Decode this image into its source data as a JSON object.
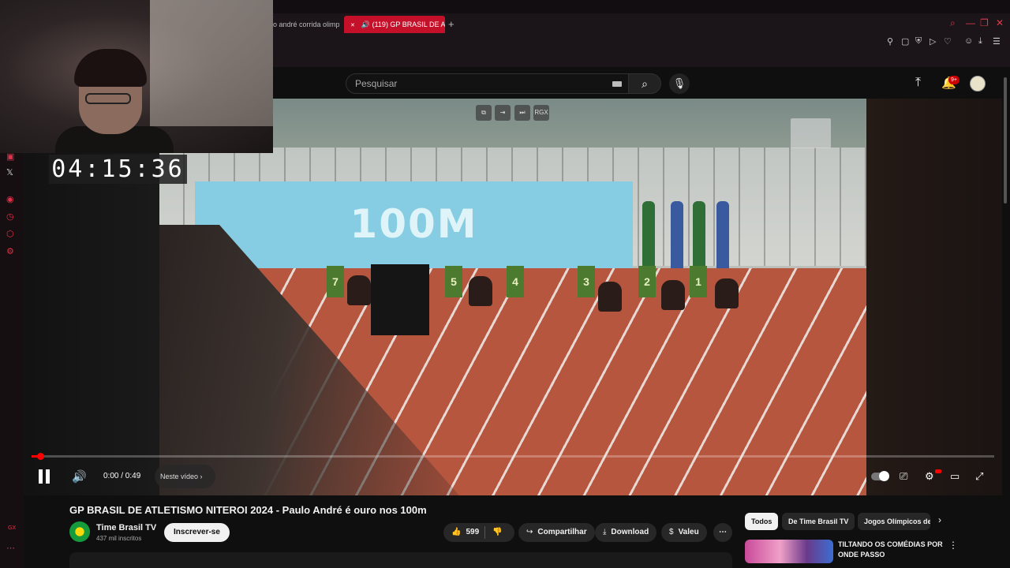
{
  "browser": {
    "tabs": [
      {
        "label": "o andré corrida olimp"
      },
      {
        "label": "(119) GP BRASIL DE A",
        "active": true
      }
    ],
    "new_tab_label": "+"
  },
  "stream_overlay": {
    "timer": "04:15:36"
  },
  "header": {
    "search_placeholder": "Pesquisar",
    "notification_count": "9+"
  },
  "player": {
    "banner_text": "100M",
    "lane_numbers": [
      "7",
      "5",
      "4",
      "3",
      "2",
      "1"
    ],
    "time_display": "0:00 / 0:49",
    "chapter_label": "Neste vídeo",
    "camera_controls": [
      "RGX"
    ],
    "progress_fraction": 0.01
  },
  "video_info": {
    "title": "GP BRASIL DE ATLETISMO NITEROI 2024 - Paulo André é ouro nos 100m",
    "channel_name": "Time Brasil TV",
    "subscribers": "437 mil inscritos",
    "subscribe_label": "Inscrever-se",
    "likes": "599",
    "share_label": "Compartilhar",
    "download_label": "Download",
    "thanks_label": "Valeu"
  },
  "recommendations": {
    "chips": [
      "Todos",
      "De Time Brasil TV",
      "Jogos Olímpicos de"
    ],
    "first_video_title": "TILTANDO OS COMÉDIAS POR ONDE PASSO"
  },
  "sidebar": {
    "gx_label": "GX"
  },
  "colors": {
    "accent": "#ff0000",
    "tab_active": "#c5102a",
    "opera_red": "#e0304a"
  }
}
